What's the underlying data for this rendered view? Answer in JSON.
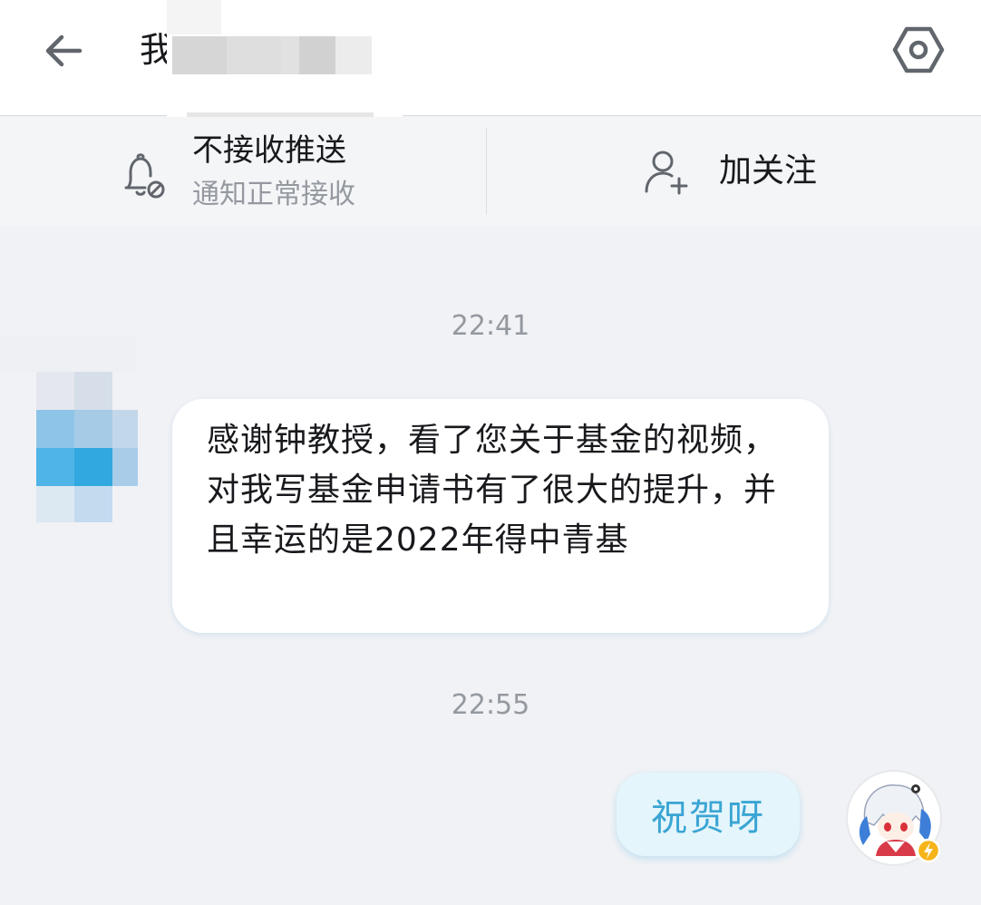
{
  "header": {
    "title": "我",
    "back_icon": "arrow-left-icon",
    "settings_icon": "hexagon-settings-icon"
  },
  "action_bar": {
    "push": {
      "icon": "bell-off-icon",
      "title": "不接收推送",
      "subtitle": "通知正常接收"
    },
    "follow": {
      "icon": "add-user-icon",
      "label": "加关注"
    }
  },
  "messages": [
    {
      "type": "time",
      "text": "22:41"
    },
    {
      "type": "incoming",
      "text": "感谢钟教授，看了您关于基金的视频，对我写基金申请书有了很大的提升，并且幸运的是2022年得中青基"
    },
    {
      "type": "time",
      "text": "22:55"
    },
    {
      "type": "outgoing",
      "text": "祝贺呀"
    }
  ],
  "colors": {
    "accent": "#3aa5d3",
    "background": "#f1f2f5",
    "text_primary": "#18191c",
    "text_secondary": "#9499a0"
  }
}
